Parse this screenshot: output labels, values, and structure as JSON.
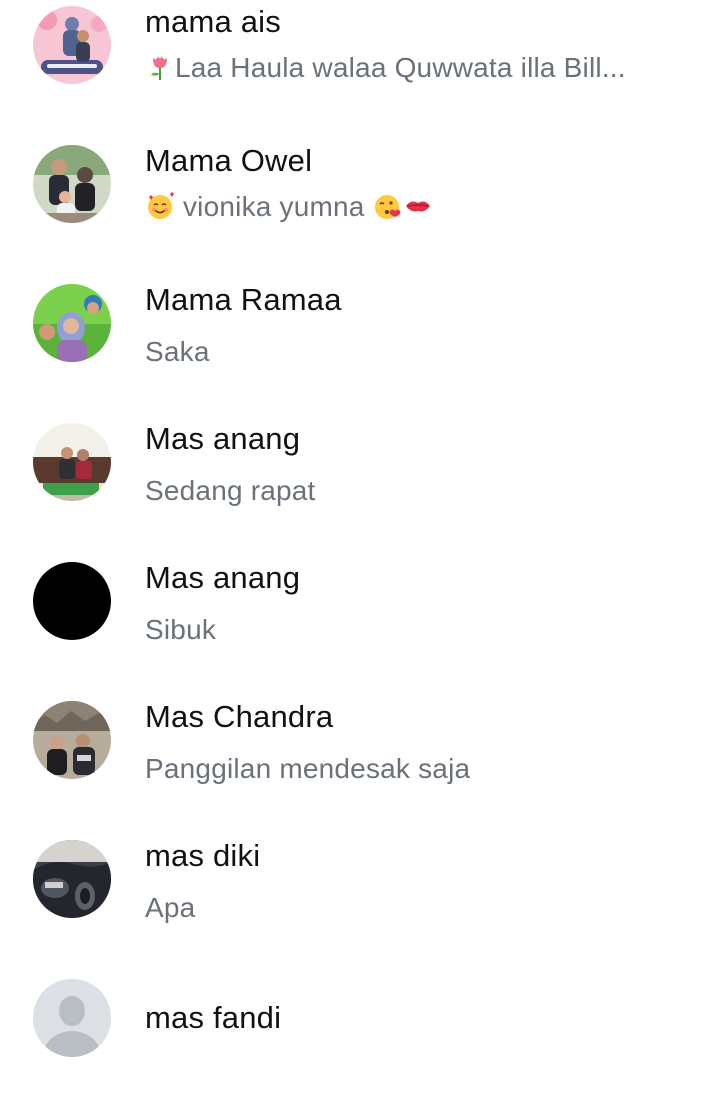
{
  "contacts": [
    {
      "name": "mama ais",
      "status_text": "Laa Haula walaa Quwwata illa Bill...",
      "status_prefix_icon": "tulip-emoji",
      "avatar": "photo-mother-children-pink-frame"
    },
    {
      "name": "Mama Owel",
      "status_text": "vionika yumna",
      "status_prefix_icon": "smiling-face-with-hearts-emoji",
      "status_suffix_icons": [
        "face-blowing-kiss-emoji",
        "kiss-mark-emoji"
      ],
      "avatar": "photo-family-group"
    },
    {
      "name": "Mama Ramaa",
      "status_text": "Saka",
      "avatar": "photo-mother-child-green"
    },
    {
      "name": "Mas anang",
      "status_text": "Sedang rapat",
      "avatar": "photo-living-room-couple"
    },
    {
      "name": "Mas anang",
      "status_text": "Sibuk",
      "avatar": "black-circle"
    },
    {
      "name": "Mas Chandra",
      "status_text": "Panggilan mendesak saja",
      "avatar": "photo-group-outdoor"
    },
    {
      "name": "mas diki",
      "status_text": "Apa",
      "avatar": "photo-car-interior"
    },
    {
      "name": "mas fandi",
      "status_text": "",
      "avatar": "default-person-placeholder"
    }
  ]
}
